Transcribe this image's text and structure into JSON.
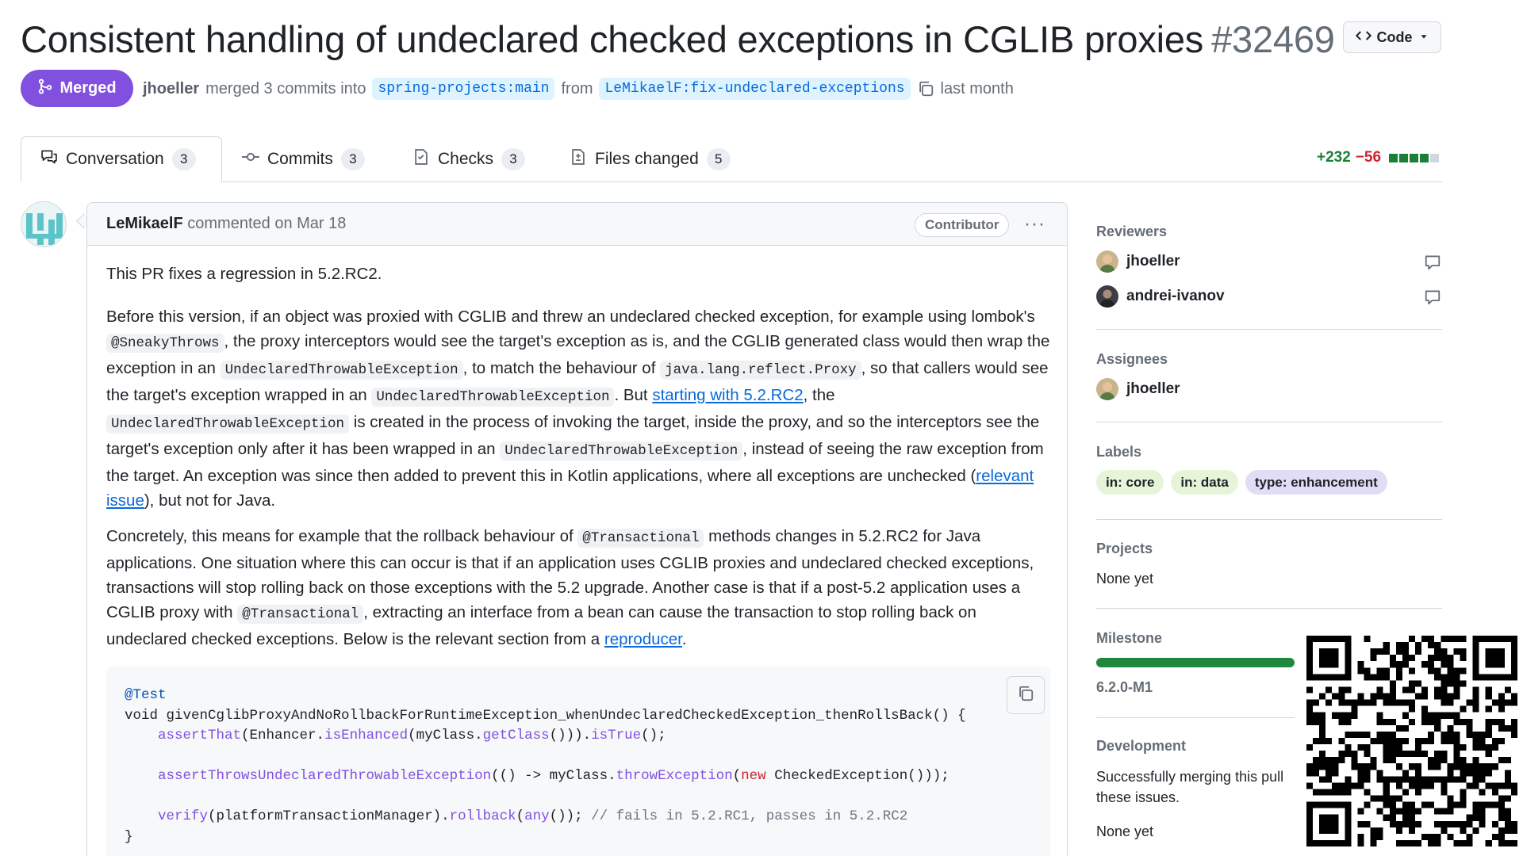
{
  "pr": {
    "title": "Consistent handling of undeclared checked exceptions in CGLIB proxies",
    "number": "#32469",
    "code_button": "Code",
    "state": "Merged",
    "author": "jhoeller",
    "merge_text": "merged 3 commits into",
    "base_branch": "spring-projects:main",
    "from_text": "from",
    "head_branch": "LeMikaelF:fix-undeclared-exceptions",
    "time": "last month"
  },
  "tabs": [
    {
      "label": "Conversation",
      "count": "3",
      "icon": "comment-discussion-icon"
    },
    {
      "label": "Commits",
      "count": "3",
      "icon": "git-commit-icon"
    },
    {
      "label": "Checks",
      "count": "3",
      "icon": "checklist-icon"
    },
    {
      "label": "Files changed",
      "count": "5",
      "icon": "file-diff-icon"
    }
  ],
  "diffstat": {
    "additions": "+232",
    "deletions": "−56",
    "colors": [
      "#1a7f37",
      "#1a7f37",
      "#1a7f37",
      "#1a7f37",
      "#d0d7de"
    ]
  },
  "comment": {
    "author": "LeMikaelF",
    "action": "commented on Mar 18",
    "role": "Contributor",
    "menu": "···",
    "p1": "This PR fixes a regression in 5.2.RC2.",
    "p2": {
      "t1": "Before this version, if an object was proxied with CGLIB and threw an undeclared checked exception, for example using lombok's ",
      "c1": "@SneakyThrows",
      "t2": ", the proxy interceptors would see the target's exception as is, and the CGLIB generated class would then wrap the exception in an ",
      "c2": "UndeclaredThrowableException",
      "t3": ", to match the behaviour of ",
      "c3": "java.lang.reflect.Proxy",
      "t4": ", so that callers would see the target's exception wrapped in an ",
      "c4": "UndeclaredThrowableException",
      "t5": ". But ",
      "l1": "starting with 5.2.RC2",
      "t6": ", the ",
      "c5": "UndeclaredThrowableException",
      "t7": " is created in the process of invoking the target, inside the proxy, and so the interceptors see the target's exception only after it has been wrapped in an ",
      "c6": "UndeclaredThrowableException",
      "t8": ", instead of seeing the raw exception from the target. An exception was since then added to prevent this in Kotlin applications, where all exceptions are unchecked (",
      "l2": "relevant issue",
      "t9": "), but not for Java."
    },
    "p3": {
      "t1": "Concretely, this means for example that the rollback behaviour of ",
      "c1": "@Transactional",
      "t2": " methods changes in 5.2.RC2 for Java applications. One situation where this can occur is that if an application uses CGLIB proxies and undeclared checked exceptions, transactions will stop rolling back on those exceptions with the 5.2 upgrade. Another case is that if a post-5.2 application uses a CGLIB proxy with ",
      "c2": "@Transactional",
      "t3": ", extracting an interface from a bean can cause the transaction to stop rolling back on undeclared checked exceptions. Below is the relevant section from a ",
      "l1": "reproducer",
      "t4": "."
    },
    "code": {
      "l1_ann": "@Test",
      "l2": "void givenCglibProxyAndNoRollbackForRuntimeException_whenUndeclaredCheckedException_thenRollsBack() {",
      "l3_f1": "assertThat",
      "l3_t1": "(Enhancer.",
      "l3_f2": "isEnhanced",
      "l3_t2": "(myClass.",
      "l3_f3": "getClass",
      "l3_t3": "())).",
      "l3_f4": "isTrue",
      "l3_t4": "();",
      "l5_f1": "assertThrowsUndeclaredThrowableException",
      "l5_t1": "(() -> myClass.",
      "l5_f2": "throwException",
      "l5_t2": "(",
      "l5_k": "new",
      "l5_t3": " CheckedException()));",
      "l7_f1": "verify",
      "l7_t1": "(platformTransactionManager).",
      "l7_f2": "rollback",
      "l7_t2": "(",
      "l7_f3": "any",
      "l7_t3": "()); ",
      "l7_c": "// fails in 5.2.RC1, passes in 5.2.RC2",
      "l8": "}"
    }
  },
  "sidebar": {
    "reviewers_h": "Reviewers",
    "reviewers": [
      "jhoeller",
      "andrei-ivanov"
    ],
    "assignees_h": "Assignees",
    "assignee": "jhoeller",
    "labels_h": "Labels",
    "labels": [
      {
        "name": "in: core",
        "color": "#e6f4d7"
      },
      {
        "name": "in: data",
        "color": "#e6f4d7"
      },
      {
        "name": "type: enhancement",
        "color": "#e3dcf6"
      }
    ],
    "projects_h": "Projects",
    "projects_v": "None yet",
    "milestone_h": "Milestone",
    "milestone_v": "6.2.0-M1",
    "milestone_progress": 1.0,
    "development_h": "Development",
    "development_t": "Successfully merging this pull",
    "development_t2": "these issues.",
    "development_v": "None yet"
  }
}
